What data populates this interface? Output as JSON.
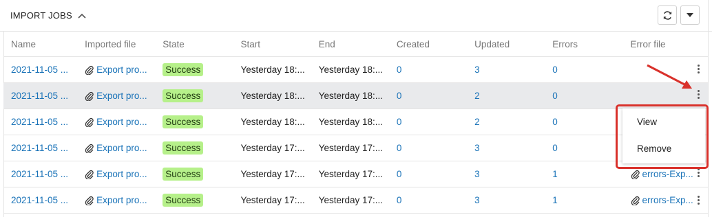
{
  "header": {
    "title": "IMPORT JOBS"
  },
  "icons": {
    "collapse": "chevron-up-icon",
    "refresh": "refresh-icon",
    "more": "caret-down-icon",
    "attachment": "paperclip-icon",
    "row_menu": "kebab-menu-icon"
  },
  "columns": [
    "Name",
    "Imported file",
    "State",
    "Start",
    "End",
    "Created",
    "Updated",
    "Errors",
    "Error file"
  ],
  "rows": [
    {
      "name": "2021-11-05 ...",
      "file": "Export pro...",
      "state": "Success",
      "start": "Yesterday 18:...",
      "end": "Yesterday 18:...",
      "created": "0",
      "updated": "3",
      "errors": "0",
      "error_file": ""
    },
    {
      "name": "2021-11-05 ...",
      "file": "Export pro...",
      "state": "Success",
      "start": "Yesterday 18:...",
      "end": "Yesterday 18:...",
      "created": "0",
      "updated": "2",
      "errors": "0",
      "error_file": ""
    },
    {
      "name": "2021-11-05 ...",
      "file": "Export pro...",
      "state": "Success",
      "start": "Yesterday 18:...",
      "end": "Yesterday 18:...",
      "created": "0",
      "updated": "2",
      "errors": "0",
      "error_file": ""
    },
    {
      "name": "2021-11-05 ...",
      "file": "Export pro...",
      "state": "Success",
      "start": "Yesterday 17:...",
      "end": "Yesterday 17:...",
      "created": "0",
      "updated": "3",
      "errors": "0",
      "error_file": ""
    },
    {
      "name": "2021-11-05 ...",
      "file": "Export pro...",
      "state": "Success",
      "start": "Yesterday 17:...",
      "end": "Yesterday 17:...",
      "created": "0",
      "updated": "3",
      "errors": "1",
      "error_file": "errors-Exp..."
    },
    {
      "name": "2021-11-05 ...",
      "file": "Export pro...",
      "state": "Success",
      "start": "Yesterday 17:...",
      "end": "Yesterday 17:...",
      "created": "0",
      "updated": "3",
      "errors": "1",
      "error_file": "errors-Exp..."
    }
  ],
  "context_menu": {
    "items": [
      "View",
      "Remove"
    ]
  },
  "colors": {
    "success_badge": "#b6f08a",
    "link": "#1a73b8",
    "highlight_row": "#e9eaec",
    "annotation": "#d9312b"
  }
}
